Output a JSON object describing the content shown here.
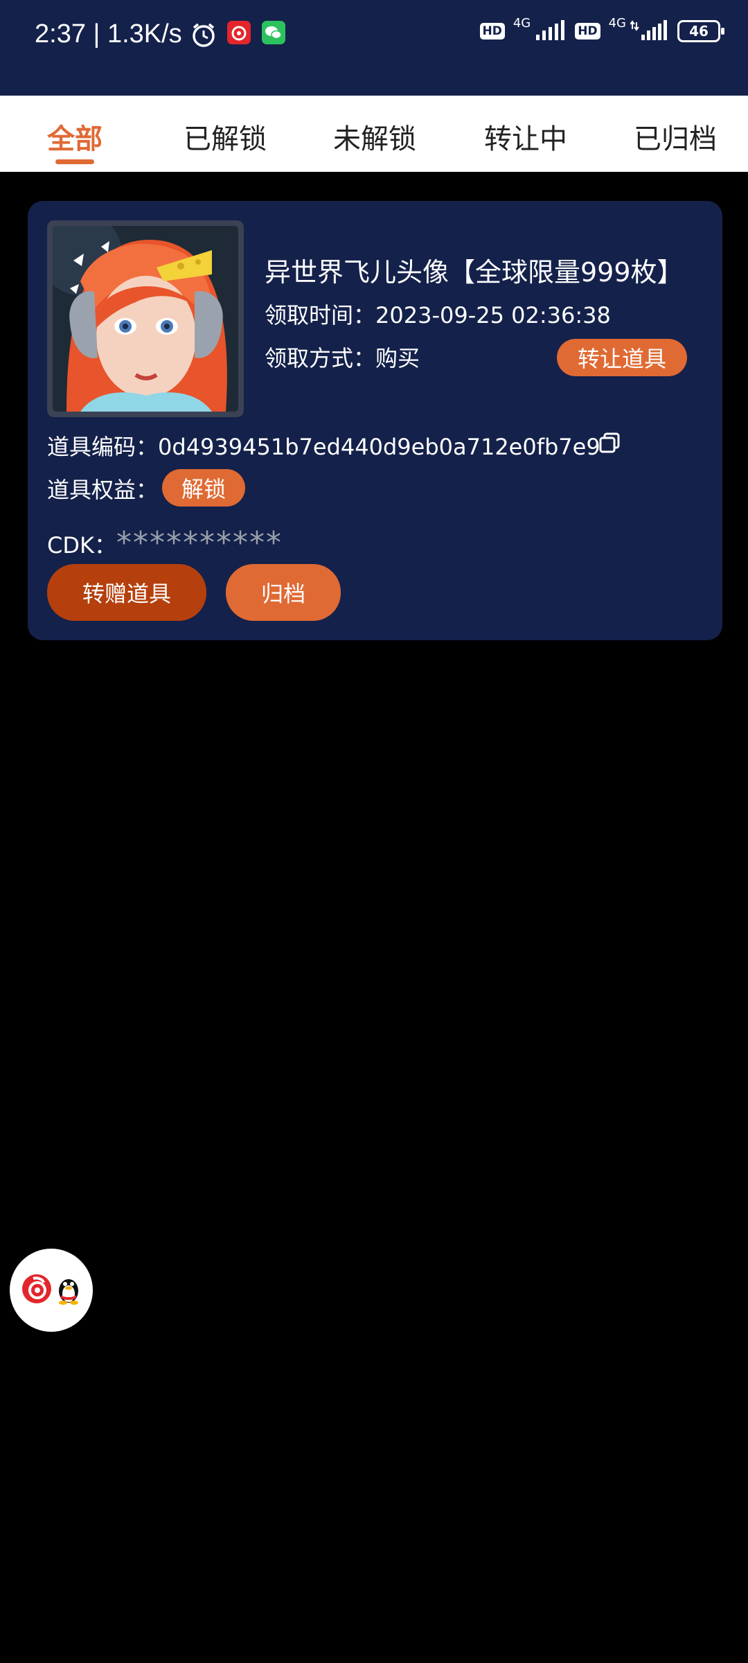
{
  "status_bar": {
    "time": "2:37 | 1.3K/s",
    "hd1": "HD",
    "net1": "4G",
    "hd2": "HD",
    "net2": "4G",
    "battery": "46"
  },
  "tabs": [
    {
      "label": "全部",
      "active": true
    },
    {
      "label": "已解锁",
      "active": false
    },
    {
      "label": "未解锁",
      "active": false
    },
    {
      "label": "转让中",
      "active": false
    },
    {
      "label": "已归档",
      "active": false
    }
  ],
  "item": {
    "title": "异世界飞儿头像【全球限量999枚】",
    "claim_time_label": "领取时间：",
    "claim_time": "2023-09-25 02:36:38",
    "claim_method_label": "领取方式：",
    "claim_method": "购买",
    "transfer_item_button": "转让道具",
    "code_label": "道具编码：",
    "code": "0d4939451b7ed440d9eb0a712e0fb7e9",
    "benefit_label": "道具权益：",
    "benefit_badge": "解锁",
    "cdk_label": "CDK：",
    "cdk_value": "**********",
    "gift_button": "转赠道具",
    "archive_button": "归档"
  },
  "colors": {
    "accent": "#e06a34",
    "card_bg": "#14214a",
    "gift_button_bg": "#b5400d"
  }
}
